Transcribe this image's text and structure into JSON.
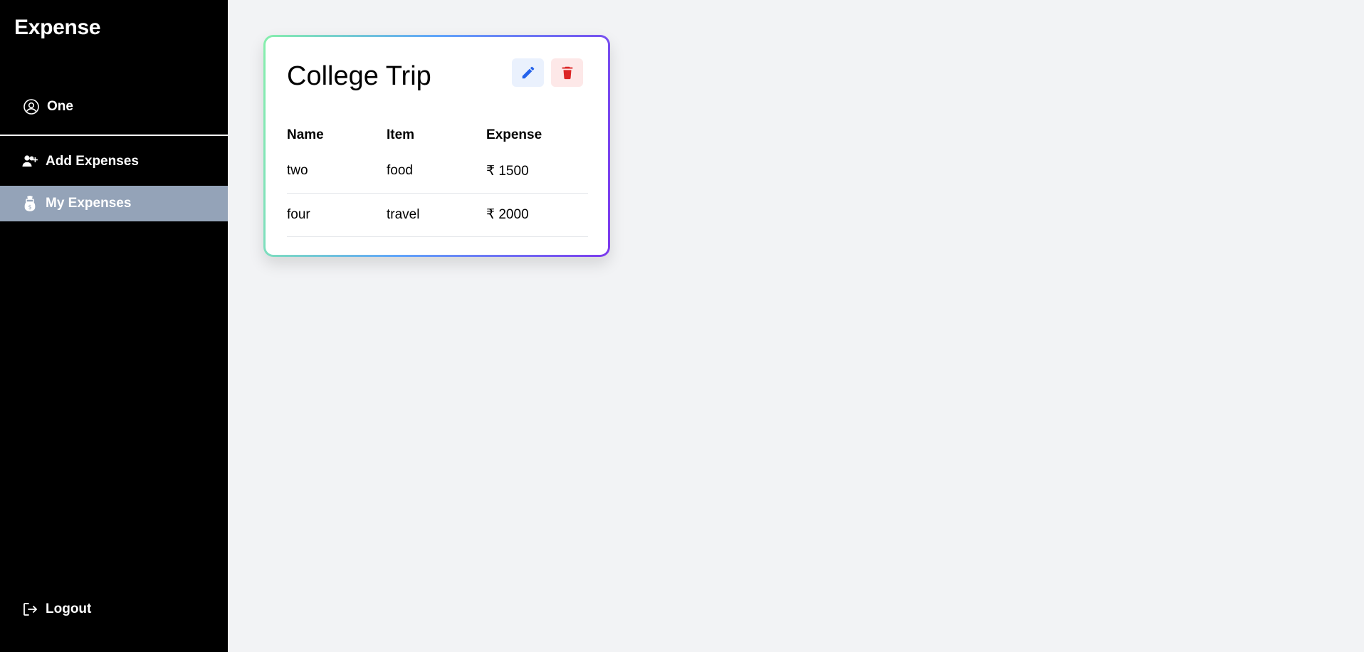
{
  "sidebar": {
    "brand": "Expense",
    "user": {
      "name": "One",
      "icon": "user-circle-icon"
    },
    "items": [
      {
        "label": "Add Expenses",
        "icon": "user-plus-icon"
      },
      {
        "label": "My Expenses",
        "icon": "money-icon",
        "active": true
      }
    ],
    "logout": {
      "label": "Logout",
      "icon": "logout-icon"
    }
  },
  "card": {
    "title": "College Trip",
    "actions": {
      "edit_icon": "pencil-icon",
      "delete_icon": "trash-icon"
    },
    "columns": [
      "Name",
      "Item",
      "Expense"
    ],
    "rows": [
      [
        "two",
        "food",
        "₹ 1500"
      ],
      [
        "four",
        "travel",
        "₹ 2000"
      ]
    ]
  },
  "colors": {
    "sidebar_bg": "#000000",
    "active_item_bg": "#94a3b8",
    "page_bg": "#f2f3f5",
    "edit_icon": "#2563eb",
    "delete_icon": "#dc2626"
  }
}
